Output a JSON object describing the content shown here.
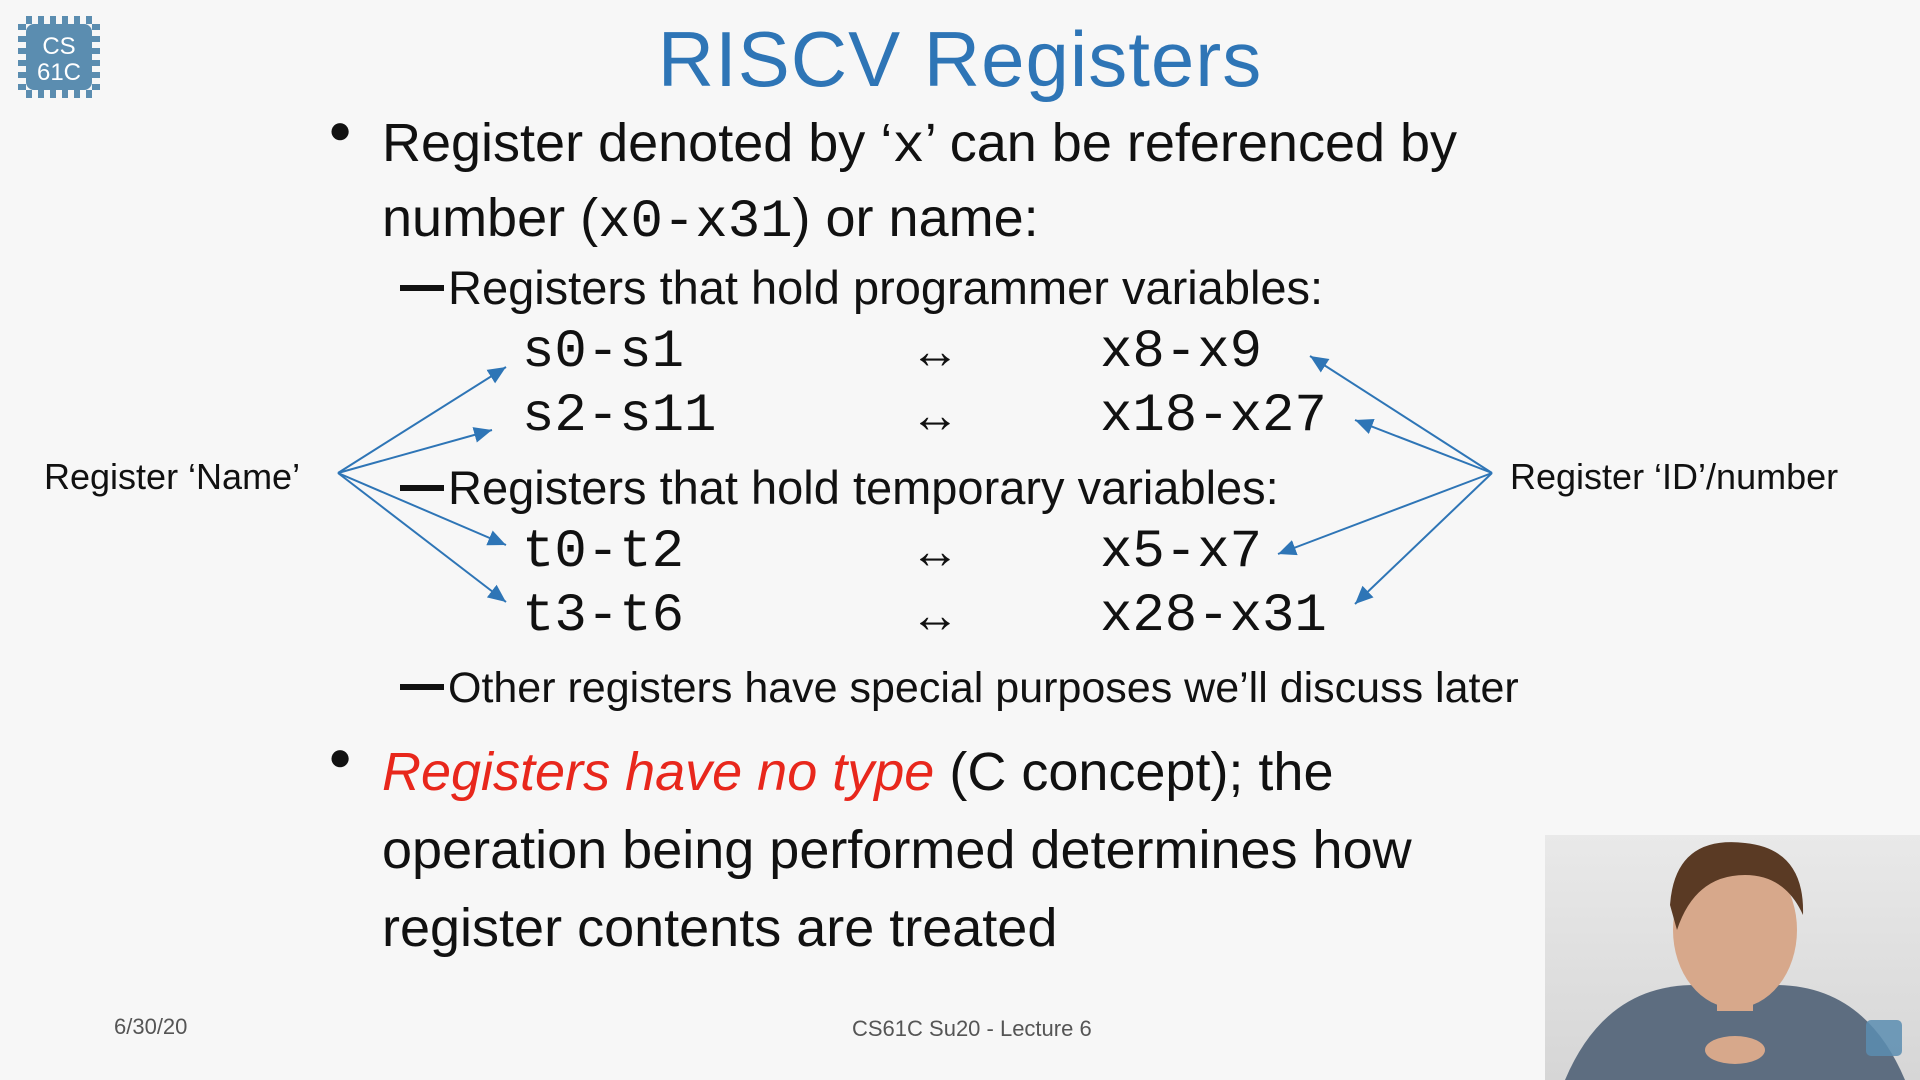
{
  "slide": {
    "title": "RISCV Registers",
    "bullet1": {
      "line1_prefix": "Register denoted by ‘",
      "line1_code": "x",
      "line1_suffix": "’ can be referenced by",
      "line2_prefix": "number (",
      "line2_code": "x0-x31",
      "line2_suffix": ") or name:"
    },
    "sub1": "Registers that hold programmer variables:",
    "sub2": "Registers that hold temporary variables:",
    "sub3": "Other registers have special purposes we’ll discuss later",
    "mappings": [
      {
        "name": "s0-s1",
        "arrow": "↔",
        "id": "x8-x9"
      },
      {
        "name": "s2-s11",
        "arrow": "↔",
        "id": "x18-x27"
      },
      {
        "name": "t0-t2",
        "arrow": "↔",
        "id": "x5-x7"
      },
      {
        "name": "t3-t6",
        "arrow": "↔",
        "id": "x28-x31"
      }
    ],
    "left_label": "Register ‘Name’",
    "right_label": "Register ‘ID’/number",
    "bullet2": {
      "emphasis": "Registers have no type",
      "rest1": " (C concept); the",
      "line2": "operation being performed determines how",
      "line3": "register contents are treated"
    }
  },
  "footer": {
    "date": "6/30/20",
    "course": "CS61C Su20 - Lecture 6"
  },
  "logo": {
    "text_top": "CS",
    "text_bottom": "61C"
  },
  "colors": {
    "title": "#2e75b6",
    "emphasis": "#e8271c",
    "arrows": "#2e75b6"
  }
}
